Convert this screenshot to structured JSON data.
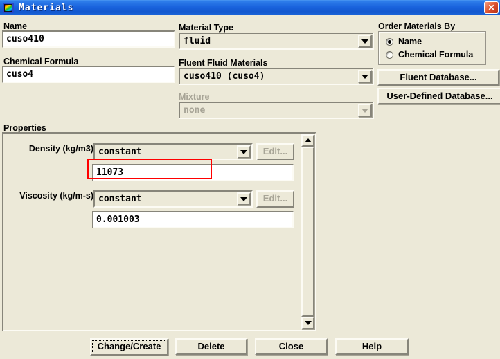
{
  "window": {
    "title": "Materials",
    "close_glyph": "✕"
  },
  "left": {
    "name_label": "Name",
    "name_value": "cuso410",
    "formula_label": "Chemical Formula",
    "formula_value": "cuso4"
  },
  "middle": {
    "material_type_label": "Material Type",
    "material_type_value": "fluid",
    "fluent_fluid_label": "Fluent Fluid Materials",
    "fluent_fluid_value": "cuso410 (cuso4)",
    "mixture_label": "Mixture",
    "mixture_value": "none",
    "mixture_disabled": true
  },
  "order": {
    "label": "Order Materials By",
    "options": [
      {
        "label": "Name",
        "selected": true
      },
      {
        "label": "Chemical Formula",
        "selected": false
      }
    ]
  },
  "database": {
    "fluent": "Fluent Database...",
    "user_defined": "User-Defined Database..."
  },
  "properties": {
    "label": "Properties",
    "rows": [
      {
        "label": "Density (kg/m3)",
        "method": "constant",
        "edit": "Edit...",
        "value": "11073",
        "highlighted": true
      },
      {
        "label": "Viscosity (kg/m-s)",
        "method": "constant",
        "edit": "Edit...",
        "value": "0.001003",
        "highlighted": false
      }
    ],
    "annotation_color": "#ff0000"
  },
  "actions": {
    "change_create": "Change/Create",
    "delete": "Delete",
    "close": "Close",
    "help": "Help"
  },
  "colors": {
    "background": "#ece9d8",
    "titlebar_blue": "#1a63dd",
    "close_red": "#d6492a",
    "highlight_red": "#ff0000",
    "disabled_text": "#a7a496"
  }
}
